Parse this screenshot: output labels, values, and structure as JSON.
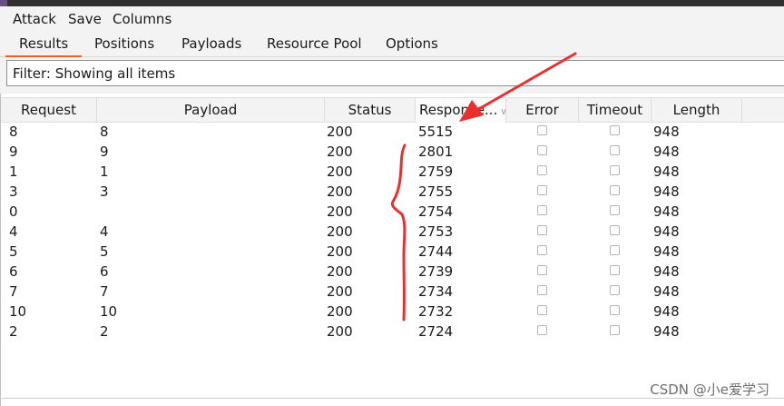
{
  "menu": [
    "Attack",
    "Save",
    "Columns"
  ],
  "tabs": [
    "Results",
    "Positions",
    "Payloads",
    "Resource Pool",
    "Options"
  ],
  "active_tab": "Results",
  "filter": {
    "text": "Filter: Showing all items"
  },
  "columns": [
    "Request",
    "Payload",
    "Status",
    "Response...",
    "Error",
    "Timeout",
    "Length"
  ],
  "rows": [
    {
      "request": "8",
      "payload": "8",
      "status": "200",
      "response": "5515",
      "length": "948"
    },
    {
      "request": "9",
      "payload": "9",
      "status": "200",
      "response": "2801",
      "length": "948"
    },
    {
      "request": "1",
      "payload": "1",
      "status": "200",
      "response": "2759",
      "length": "948"
    },
    {
      "request": "3",
      "payload": "3",
      "status": "200",
      "response": "2755",
      "length": "948"
    },
    {
      "request": "0",
      "payload": "",
      "status": "200",
      "response": "2754",
      "length": "948"
    },
    {
      "request": "4",
      "payload": "4",
      "status": "200",
      "response": "2753",
      "length": "948"
    },
    {
      "request": "5",
      "payload": "5",
      "status": "200",
      "response": "2744",
      "length": "948"
    },
    {
      "request": "6",
      "payload": "6",
      "status": "200",
      "response": "2739",
      "length": "948"
    },
    {
      "request": "7",
      "payload": "7",
      "status": "200",
      "response": "2734",
      "length": "948"
    },
    {
      "request": "10",
      "payload": "10",
      "status": "200",
      "response": "2732",
      "length": "948"
    },
    {
      "request": "2",
      "payload": "2",
      "status": "200",
      "response": "2724",
      "length": "948"
    }
  ],
  "watermark": "CSDN @小e爱学习",
  "colors": {
    "accent": "#e8632b",
    "annotation": "#e8302f"
  },
  "icons": {
    "sort": "sort-chevron-icon",
    "annotation_arrow": "arrow-icon"
  }
}
